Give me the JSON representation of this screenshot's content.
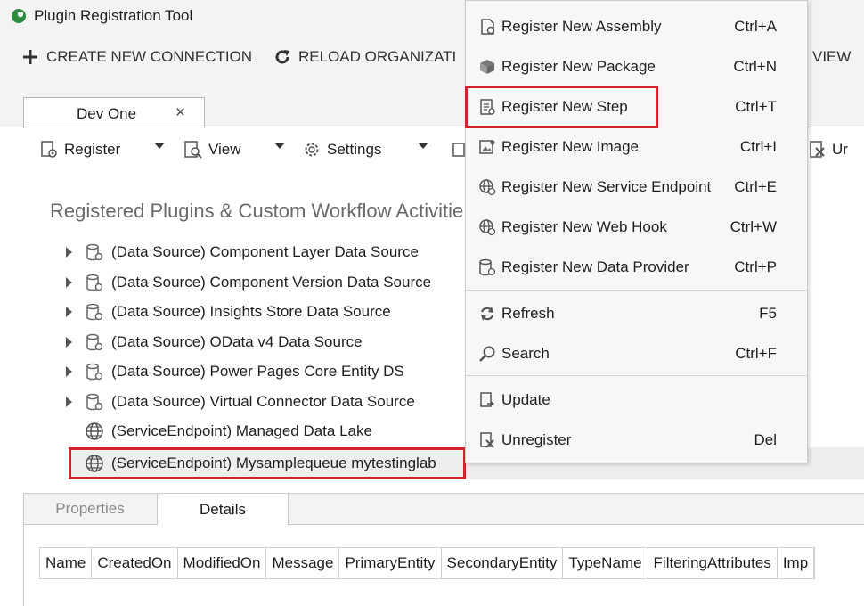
{
  "window": {
    "title": "Plugin Registration Tool"
  },
  "toolbar": {
    "create_label": "CREATE NEW CONNECTION",
    "reload_label": "RELOAD ORGANIZATI",
    "view_label": "VIEW"
  },
  "connection_tab": {
    "label": "Dev One",
    "close": "×"
  },
  "inner_toolbar": {
    "register_label": "Register",
    "view_label": "View",
    "settings_label": "Settings",
    "unregister_partial": "Ur"
  },
  "tree": {
    "heading": "Registered Plugins & Custom Workflow Activitie",
    "items": [
      {
        "label": "(Data Source) Component Layer Data Source",
        "icon": "datasource-icon",
        "expandable": true
      },
      {
        "label": "(Data Source) Component Version Data Source",
        "icon": "datasource-icon",
        "expandable": true
      },
      {
        "label": "(Data Source) Insights Store Data Source",
        "icon": "datasource-icon",
        "expandable": true
      },
      {
        "label": "(Data Source) OData v4 Data Source",
        "icon": "datasource-icon",
        "expandable": true
      },
      {
        "label": "(Data Source) Power Pages Core Entity DS",
        "icon": "datasource-icon",
        "expandable": true
      },
      {
        "label": "(Data Source) Virtual Connector Data Source",
        "icon": "datasource-icon",
        "expandable": true
      },
      {
        "label": "(ServiceEndpoint) Managed Data Lake",
        "icon": "globe-icon",
        "expandable": false
      },
      {
        "label": "(ServiceEndpoint) Mysamplequeue mytestinglab",
        "icon": "globe-icon",
        "expandable": false,
        "selected": true
      }
    ]
  },
  "bottom_tabs": {
    "properties": "Properties",
    "details": "Details"
  },
  "grid": {
    "columns": [
      "Name",
      "CreatedOn",
      "ModifiedOn",
      "Message",
      "PrimaryEntity",
      "SecondaryEntity",
      "TypeName",
      "FilteringAttributes",
      "Imp"
    ]
  },
  "context_menu": {
    "items": [
      {
        "label": "Register New Assembly",
        "shortcut": "Ctrl+A",
        "icon": "assembly-icon"
      },
      {
        "label": "Register New Package",
        "shortcut": "Ctrl+N",
        "icon": "package-icon"
      },
      {
        "label": "Register New Step",
        "shortcut": "Ctrl+T",
        "icon": "step-icon",
        "highlighted": true
      },
      {
        "label": "Register New Image",
        "shortcut": "Ctrl+I",
        "icon": "image-icon"
      },
      {
        "label": "Register New Service Endpoint",
        "shortcut": "Ctrl+E",
        "icon": "endpoint-icon"
      },
      {
        "label": "Register New Web Hook",
        "shortcut": "Ctrl+W",
        "icon": "webhook-icon"
      },
      {
        "label": "Register New Data Provider",
        "shortcut": "Ctrl+P",
        "icon": "data-provider-icon"
      },
      {
        "label": "Refresh",
        "shortcut": "F5",
        "icon": "refresh-icon"
      },
      {
        "label": "Search",
        "shortcut": "Ctrl+F",
        "icon": "search-icon"
      },
      {
        "label": "Update",
        "shortcut": "",
        "icon": "update-icon"
      },
      {
        "label": "Unregister",
        "shortcut": "Del",
        "icon": "unregister-icon"
      }
    ]
  },
  "colors": {
    "highlight_border": "#d0242b",
    "app_icon_green": "#2d8a3e"
  }
}
